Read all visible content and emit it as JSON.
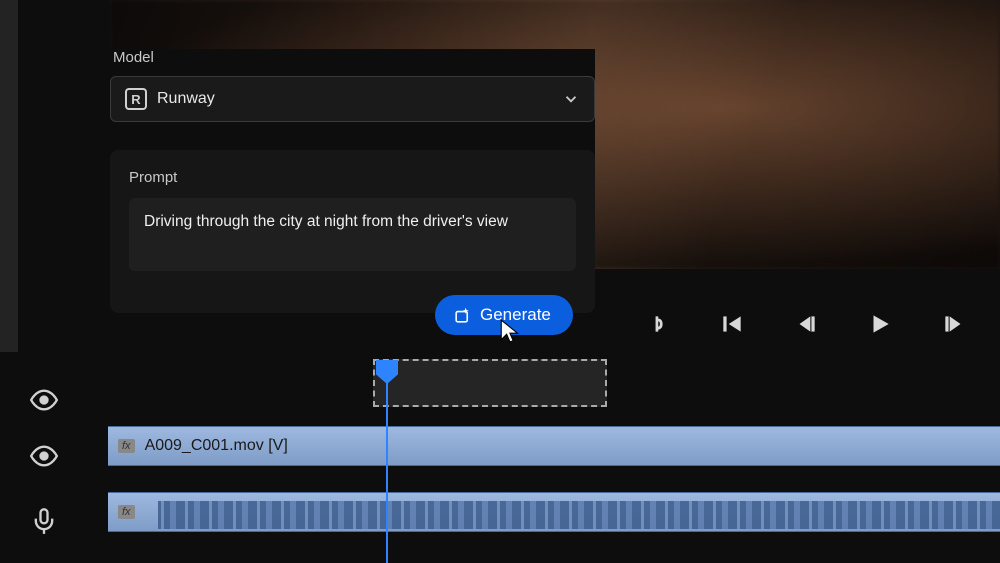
{
  "panel": {
    "model_label": "Model",
    "model_selected": "Runway",
    "model_logo_glyph": "R",
    "prompt_label": "Prompt",
    "prompt_value": "Driving through the city at night from the driver's view",
    "generate_label": "Generate"
  },
  "timeline": {
    "clip1_name": "A009_C001.mov [V]",
    "fx_badge": "fx"
  },
  "colors": {
    "accent_blue": "#0b5fde",
    "playhead_blue": "#2e84ff",
    "clip_fill": "#8fa9d2"
  }
}
